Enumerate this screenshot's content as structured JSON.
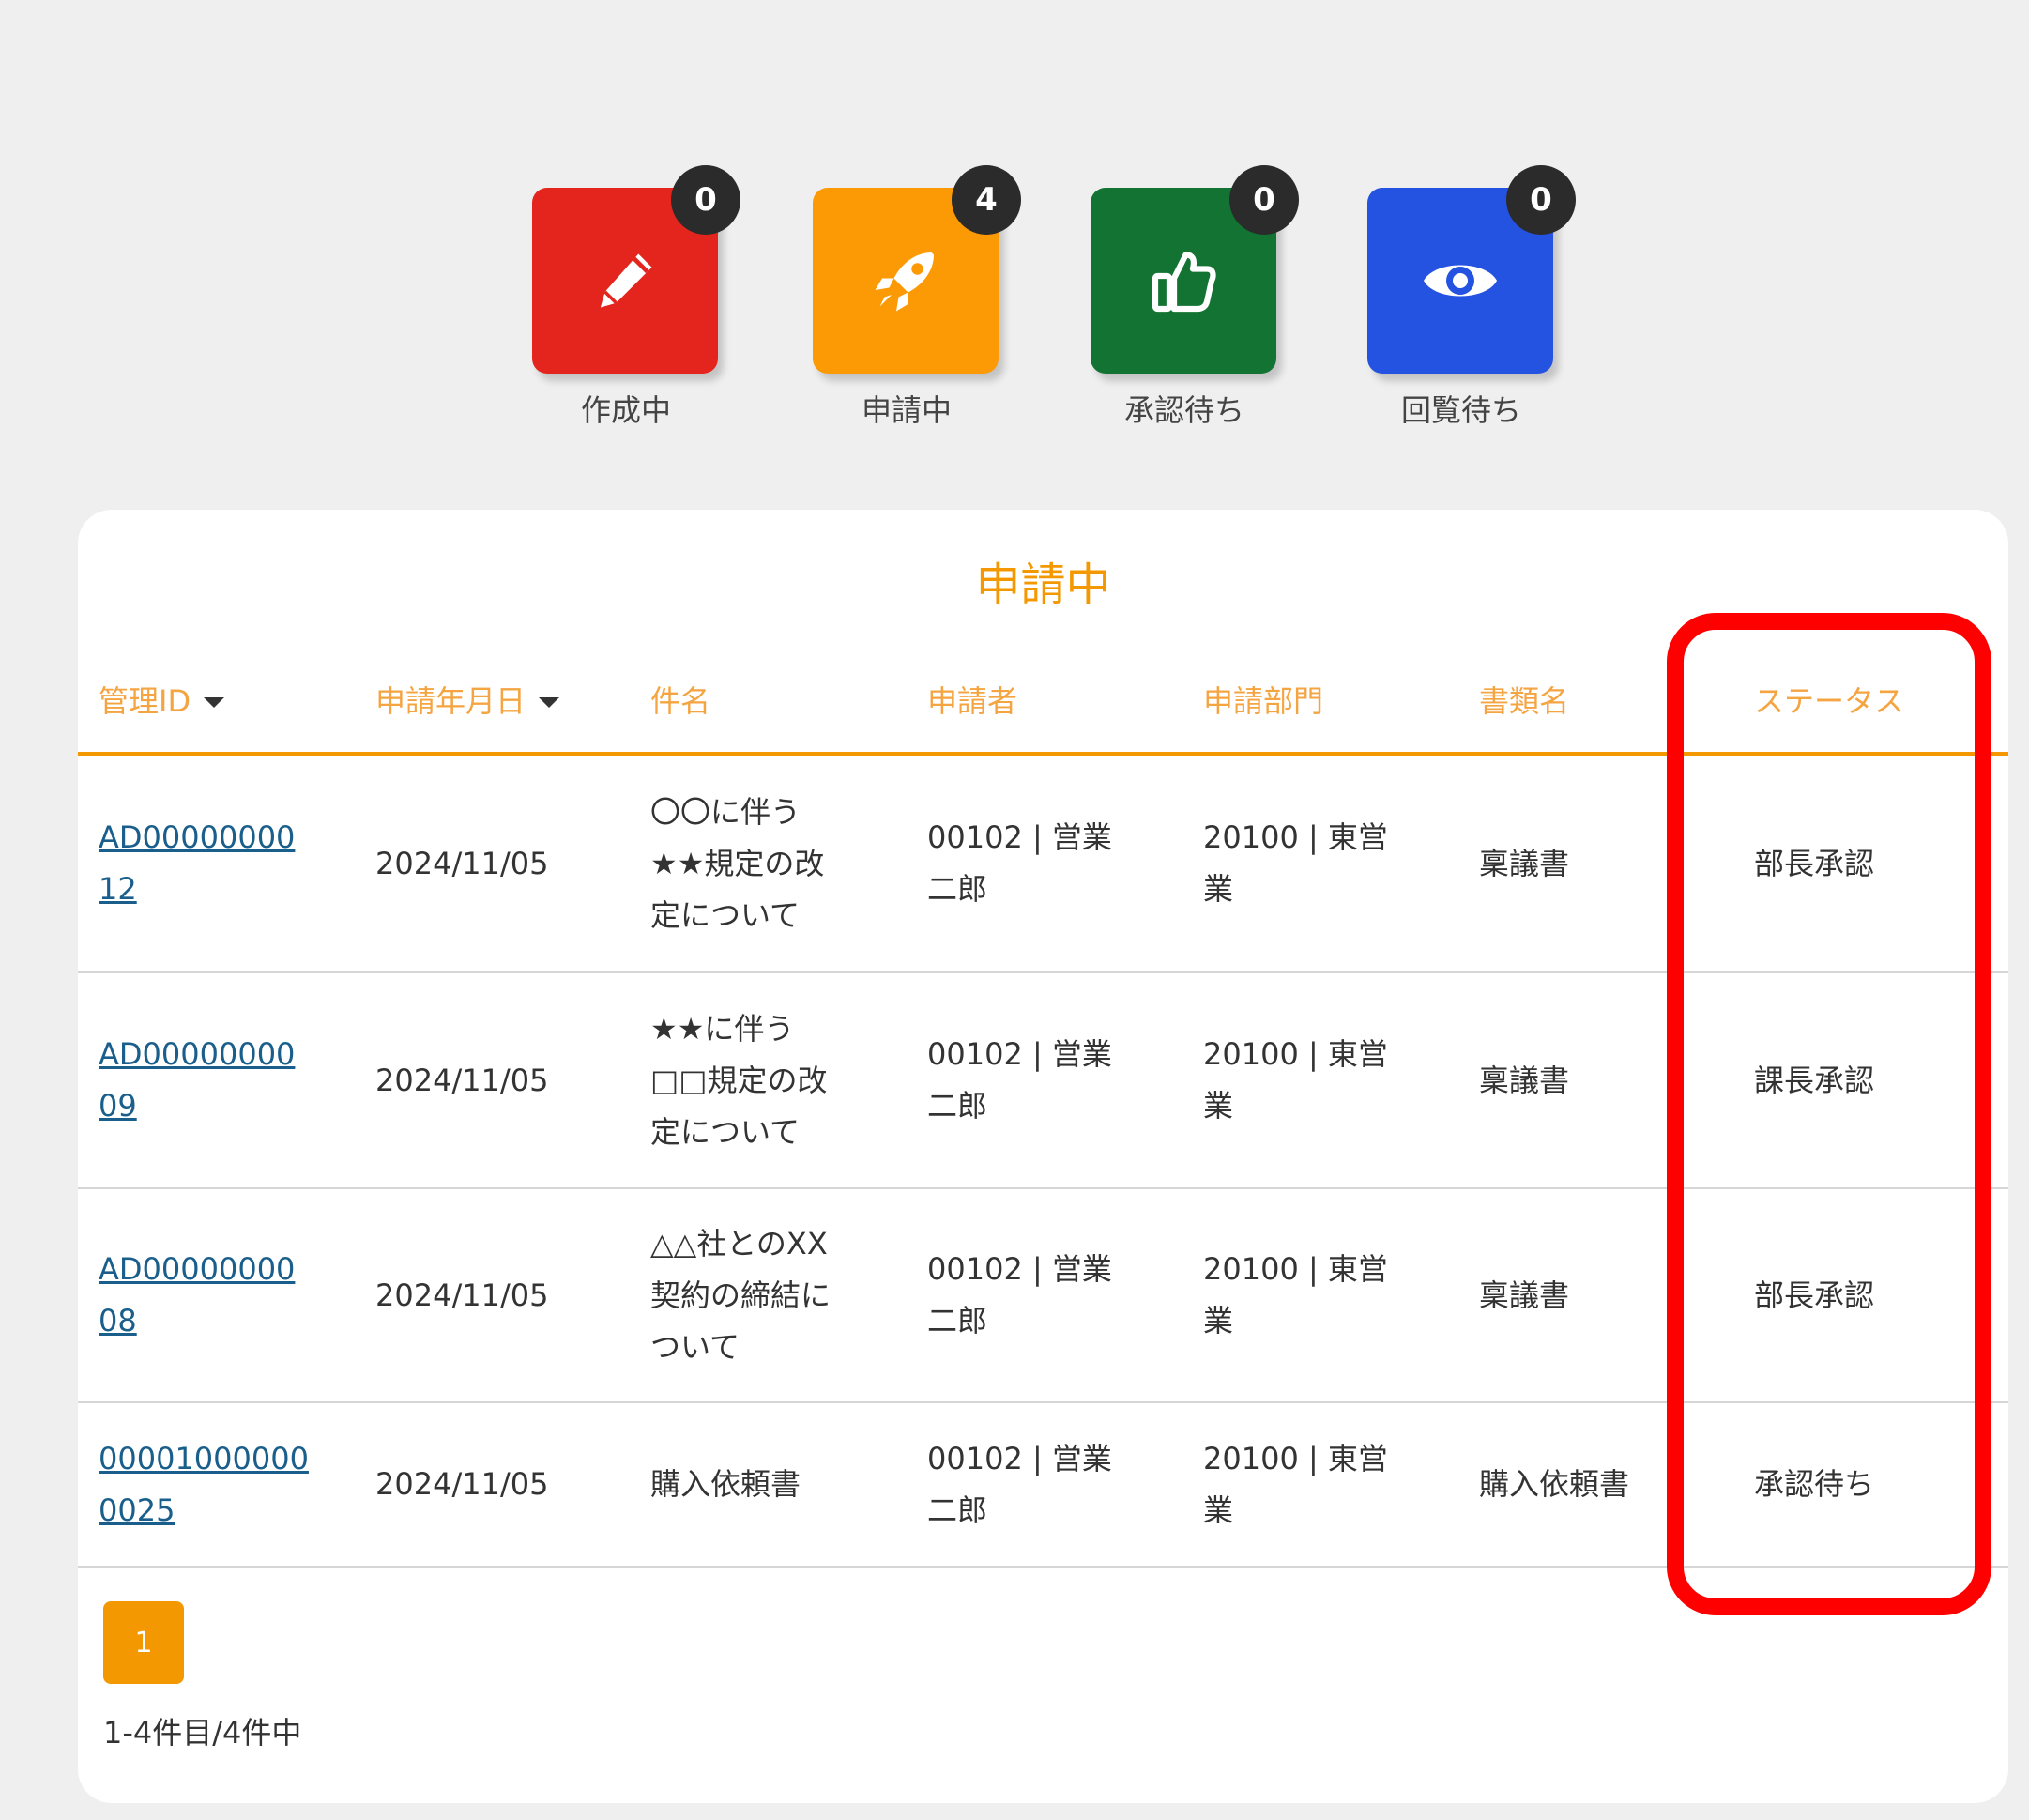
{
  "tiles": [
    {
      "label": "作成中",
      "count": "0",
      "color": "#e3251e",
      "icon": "pencil-icon"
    },
    {
      "label": "申請中",
      "count": "4",
      "color": "#fb9a05",
      "icon": "rocket-icon"
    },
    {
      "label": "承認待ち",
      "count": "0",
      "color": "#137332",
      "icon": "thumbs-up-icon"
    },
    {
      "label": "回覧待ち",
      "count": "0",
      "color": "#2452e1",
      "icon": "eye-icon"
    }
  ],
  "panel": {
    "title": "申請中",
    "columns": [
      "管理ID",
      "申請年月日",
      "件名",
      "申請者",
      "申請部門",
      "書類名",
      "ステータス"
    ],
    "rows": [
      {
        "id": [
          "AD00000000",
          "12"
        ],
        "date": "2024/11/05",
        "subject": [
          "〇〇に伴う",
          "★★規定の改",
          "定について"
        ],
        "applicant": [
          "00102 | 営業",
          "二郎"
        ],
        "department": [
          "20100 | 東営",
          "業"
        ],
        "doc": "稟議書",
        "status": "部長承認"
      },
      {
        "id": [
          "AD00000000",
          "09"
        ],
        "date": "2024/11/05",
        "subject": [
          "★★に伴う",
          "□□規定の改",
          "定について"
        ],
        "applicant": [
          "00102 | 営業",
          "二郎"
        ],
        "department": [
          "20100 | 東営",
          "業"
        ],
        "doc": "稟議書",
        "status": "課長承認"
      },
      {
        "id": [
          "AD00000000",
          "08"
        ],
        "date": "2024/11/05",
        "subject": [
          "△△社とのXX",
          "契約の締結に",
          "ついて"
        ],
        "applicant": [
          "00102 | 営業",
          "二郎"
        ],
        "department": [
          "20100 | 東営",
          "業"
        ],
        "doc": "稟議書",
        "status": "部長承認"
      },
      {
        "id": [
          "00001000000",
          "0025"
        ],
        "date": "2024/11/05",
        "subject": [
          "購入依頼書"
        ],
        "applicant": [
          "00102 | 営業",
          "二郎"
        ],
        "department": [
          "20100 | 東営",
          "業"
        ],
        "doc": "購入依頼書",
        "status": "承認待ち"
      }
    ],
    "pagination": {
      "current": "1",
      "count_text": "1-4件目/4件中"
    }
  },
  "colors": {
    "accent": "#f39800",
    "highlight": "#ff0000",
    "link": "#1a5f8c"
  }
}
